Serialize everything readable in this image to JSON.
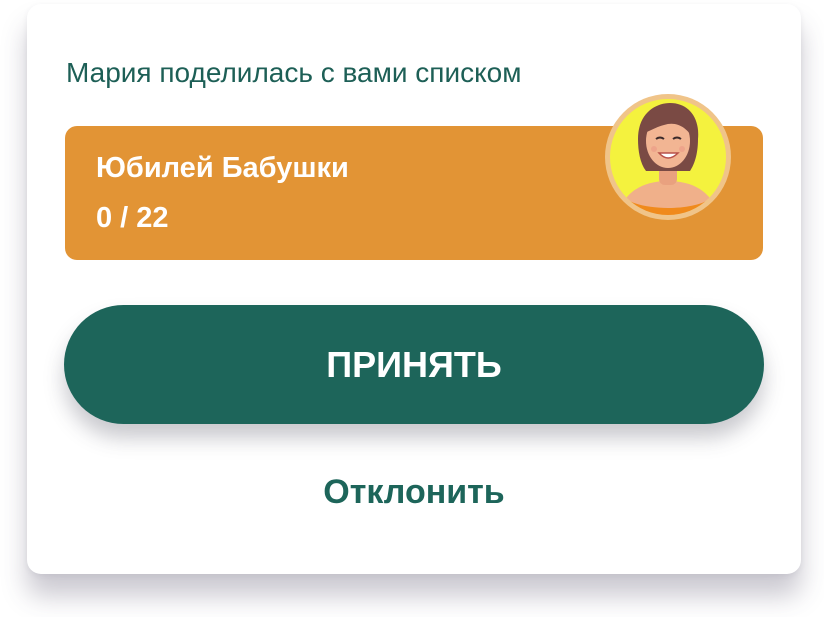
{
  "invite": {
    "message": "Мария поделилась с вами списком"
  },
  "list": {
    "title": "Юбилей Бабушки",
    "progress_text": "0 / 22",
    "card_color": "#e29435"
  },
  "avatar": {
    "icon": "woman-avatar-icon",
    "background_color": "#f4f23e"
  },
  "actions": {
    "accept_label": "ПРИНЯТЬ",
    "decline_label": "Отклонить",
    "accent_color": "#1d655a"
  }
}
